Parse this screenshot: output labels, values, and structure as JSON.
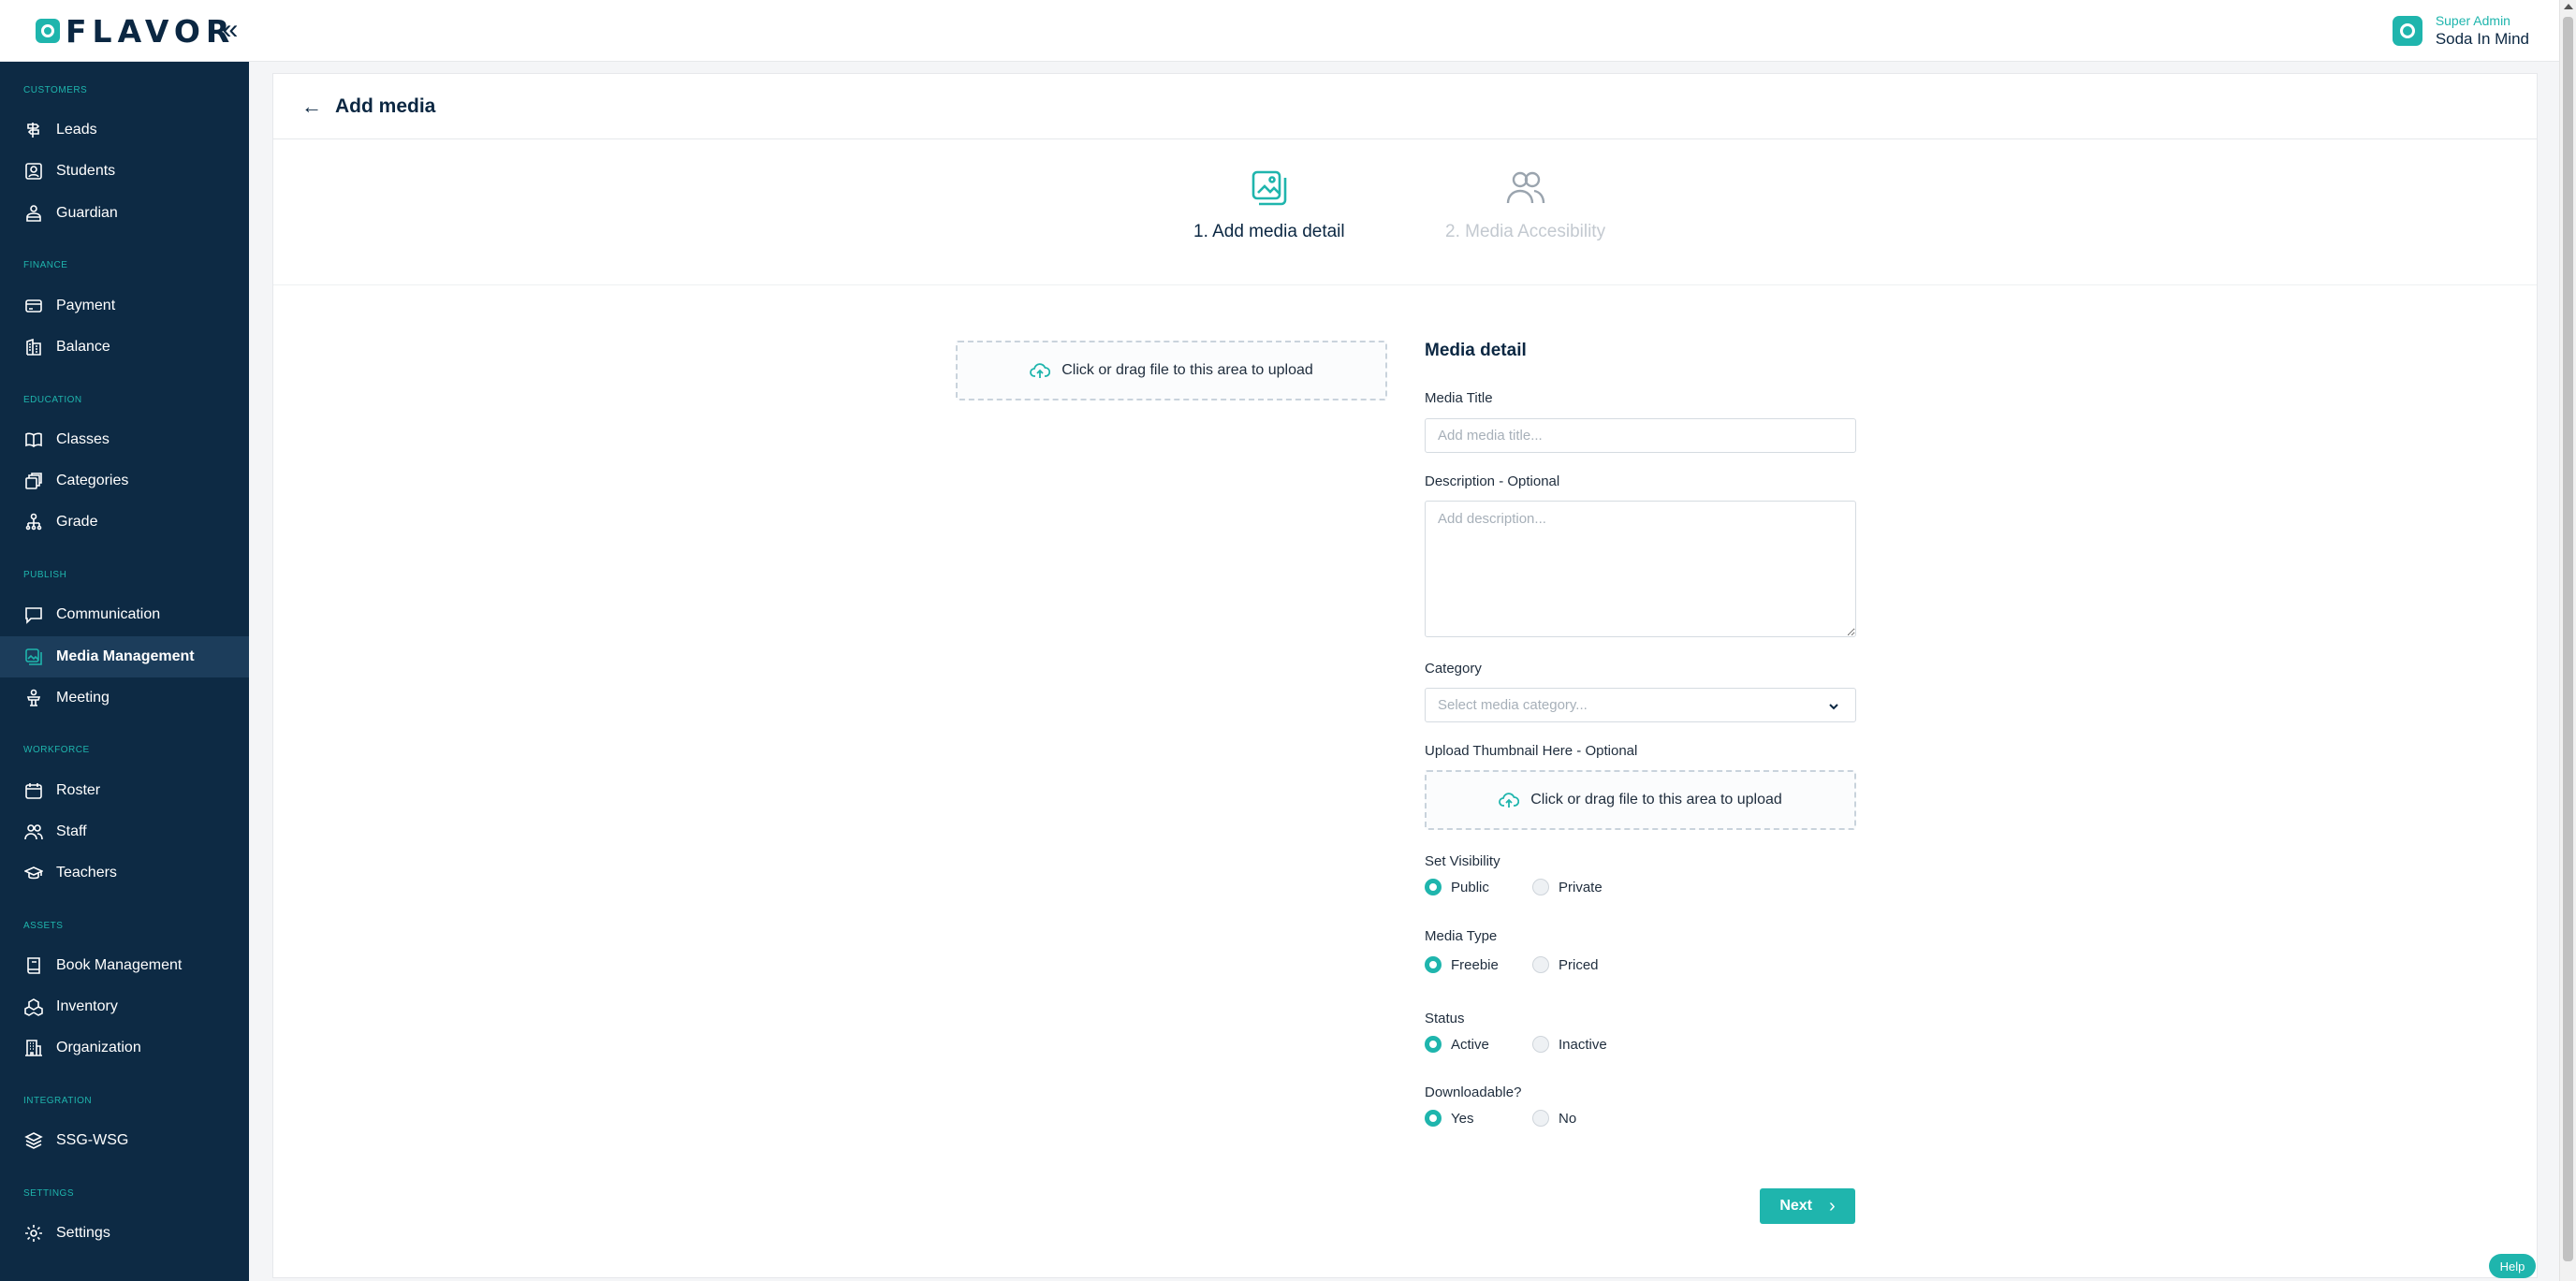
{
  "app": {
    "logo_text": "FLAVOR",
    "user_role": "Super Admin",
    "user_org": "Soda In Mind"
  },
  "sidebar": {
    "sections": [
      {
        "title": "CUSTOMERS",
        "items": [
          {
            "label": "Leads",
            "icon": "signpost-icon"
          },
          {
            "label": "Students",
            "icon": "student-card-icon"
          },
          {
            "label": "Guardian",
            "icon": "guardian-icon"
          }
        ]
      },
      {
        "title": "FINANCE",
        "items": [
          {
            "label": "Payment",
            "icon": "credit-card-icon"
          },
          {
            "label": "Balance",
            "icon": "building-icon"
          }
        ]
      },
      {
        "title": "EDUCATION",
        "items": [
          {
            "label": "Classes",
            "icon": "book-open-icon"
          },
          {
            "label": "Categories",
            "icon": "stack-icon"
          },
          {
            "label": "Grade",
            "icon": "hierarchy-icon"
          }
        ]
      },
      {
        "title": "PUBLISH",
        "items": [
          {
            "label": "Communication",
            "icon": "chat-icon"
          },
          {
            "label": "Media Management",
            "icon": "media-icon",
            "active": true
          },
          {
            "label": "Meeting",
            "icon": "podium-icon"
          }
        ]
      },
      {
        "title": "WORKFORCE",
        "items": [
          {
            "label": "Roster",
            "icon": "calendar-icon"
          },
          {
            "label": "Staff",
            "icon": "users-icon"
          },
          {
            "label": "Teachers",
            "icon": "graduation-cap-icon"
          }
        ]
      },
      {
        "title": "ASSETS",
        "items": [
          {
            "label": "Book Management",
            "icon": "book-icon"
          },
          {
            "label": "Inventory",
            "icon": "boxes-icon"
          },
          {
            "label": "Organization",
            "icon": "office-icon"
          }
        ]
      },
      {
        "title": "INTEGRATION",
        "items": [
          {
            "label": "SSG-WSG",
            "icon": "layers-icon"
          }
        ]
      },
      {
        "title": "SETTINGS",
        "items": [
          {
            "label": "Settings",
            "icon": "gear-icon"
          }
        ]
      }
    ]
  },
  "page": {
    "title": "Add media",
    "steps": [
      {
        "label": "1. Add media detail",
        "state": "active"
      },
      {
        "label": "2. Media Accesibility",
        "state": "inactive"
      }
    ],
    "upload_text": "Click or drag file to this area to upload"
  },
  "form": {
    "section_title": "Media detail",
    "media_title_label": "Media Title",
    "media_title_placeholder": "Add media title...",
    "description_label": "Description - Optional",
    "description_placeholder": "Add description...",
    "category_label": "Category",
    "category_placeholder": "Select media category...",
    "thumbnail_label": "Upload Thumbnail Here - Optional",
    "thumbnail_upload_text": "Click or drag file to this area to upload",
    "visibility": {
      "label": "Set Visibility",
      "options": [
        "Public",
        "Private"
      ],
      "selected": "Public"
    },
    "media_type": {
      "label": "Media Type",
      "options": [
        "Freebie",
        "Priced"
      ],
      "selected": "Freebie"
    },
    "status": {
      "label": "Status",
      "options": [
        "Active",
        "Inactive"
      ],
      "selected": "Active"
    },
    "downloadable": {
      "label": "Downloadable?",
      "options": [
        "Yes",
        "No"
      ],
      "selected": "Yes"
    },
    "next_label": "Next"
  },
  "help_label": "Help",
  "colors": {
    "accent": "#1fb5ad",
    "sidebar_bg": "#0d2a44",
    "sidebar_active": "#1c3d5b"
  }
}
